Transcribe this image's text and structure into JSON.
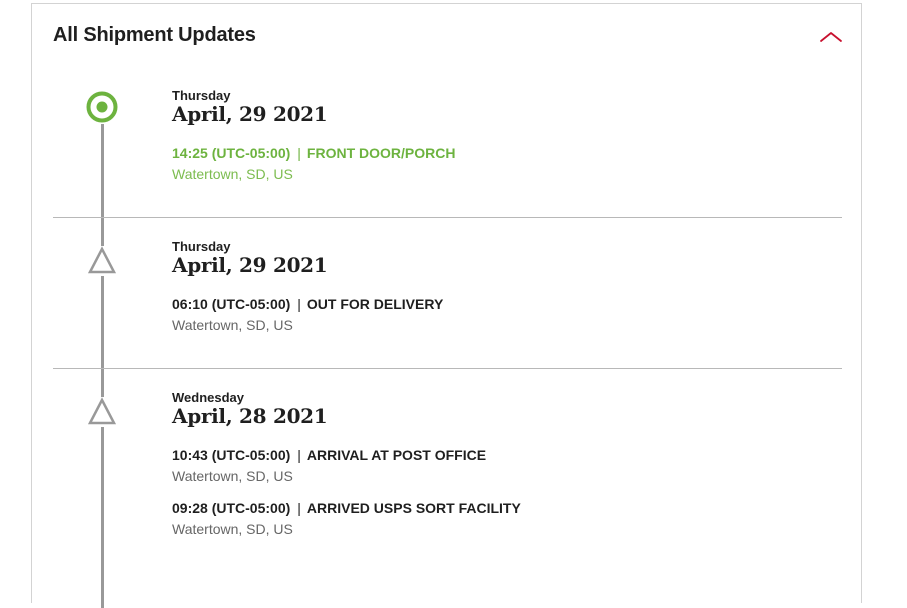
{
  "header": {
    "title": "All Shipment Updates",
    "collapse_icon": "chevron-up-icon",
    "accent_color": "#c8102e"
  },
  "colors": {
    "delivered": "#6db33f",
    "timeline": "#999999"
  },
  "groups": [
    {
      "day": "Thursday",
      "date": "April, 29 2021",
      "marker": "target-icon",
      "events": [
        {
          "time": "14:25 (UTC-05:00)",
          "separator": "|",
          "status": "FRONT DOOR/PORCH",
          "location": "Watertown, SD, US"
        }
      ]
    },
    {
      "day": "Thursday",
      "date": "April, 29 2021",
      "marker": "triangle-icon",
      "events": [
        {
          "time": "06:10 (UTC-05:00)",
          "separator": "|",
          "status": "OUT FOR DELIVERY",
          "location": "Watertown, SD, US"
        }
      ]
    },
    {
      "day": "Wednesday",
      "date": "April, 28 2021",
      "marker": "triangle-icon",
      "events": [
        {
          "time": "10:43 (UTC-05:00)",
          "separator": "|",
          "status": "ARRIVAL AT POST OFFICE",
          "location": "Watertown, SD, US"
        },
        {
          "time": "09:28 (UTC-05:00)",
          "separator": "|",
          "status": "ARRIVED USPS SORT FACILITY",
          "location": "Watertown, SD, US"
        }
      ]
    }
  ]
}
